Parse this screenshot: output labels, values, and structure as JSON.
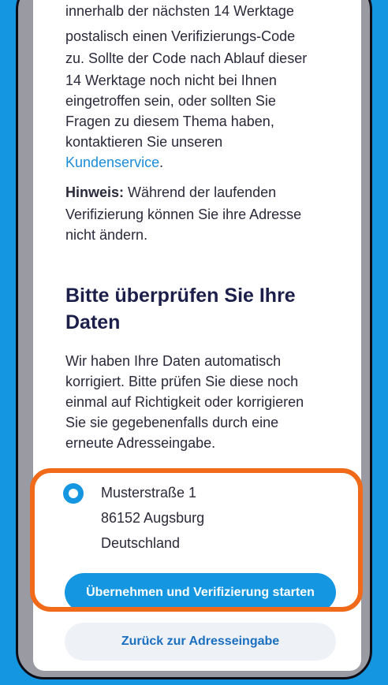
{
  "info": {
    "paragraph_lines": [
      "innerhalb der nächsten 14 Werktage",
      "postalisch einen Verifizierungs-Code",
      "zu. Sollte der Code nach Ablauf dieser",
      "14 Werktage noch nicht bei Ihnen",
      "eingetroffen sein, oder sollten Sie",
      "Fragen zu diesem Thema haben,",
      "kontaktieren Sie unseren"
    ],
    "link_text": "Kundenservice",
    "link_suffix": ".",
    "note_label": "Hinweis:",
    "note_text_line1": " Während der laufenden",
    "note_text_line2": "Verifizierung können Sie ihre Adresse",
    "note_text_line3": "nicht ändern."
  },
  "review": {
    "heading_line1": "Bitte überprüfen Sie Ihre",
    "heading_line2": "Daten",
    "body_lines": [
      "Wir haben Ihre Daten automatisch",
      "korrigiert. Bitte prüfen Sie diese noch",
      "einmal auf Richtigkeit oder korrigieren",
      "Sie sie gegebenenfalls durch eine",
      "erneute Adresseingabe."
    ]
  },
  "address": {
    "street": "Musterstraße 1",
    "city": "86152 Augsburg",
    "country": "Deutschland"
  },
  "actions": {
    "primary_label": "Übernehmen und Verifizierung starten",
    "secondary_label": "Zurück zur Adresseingabe"
  }
}
